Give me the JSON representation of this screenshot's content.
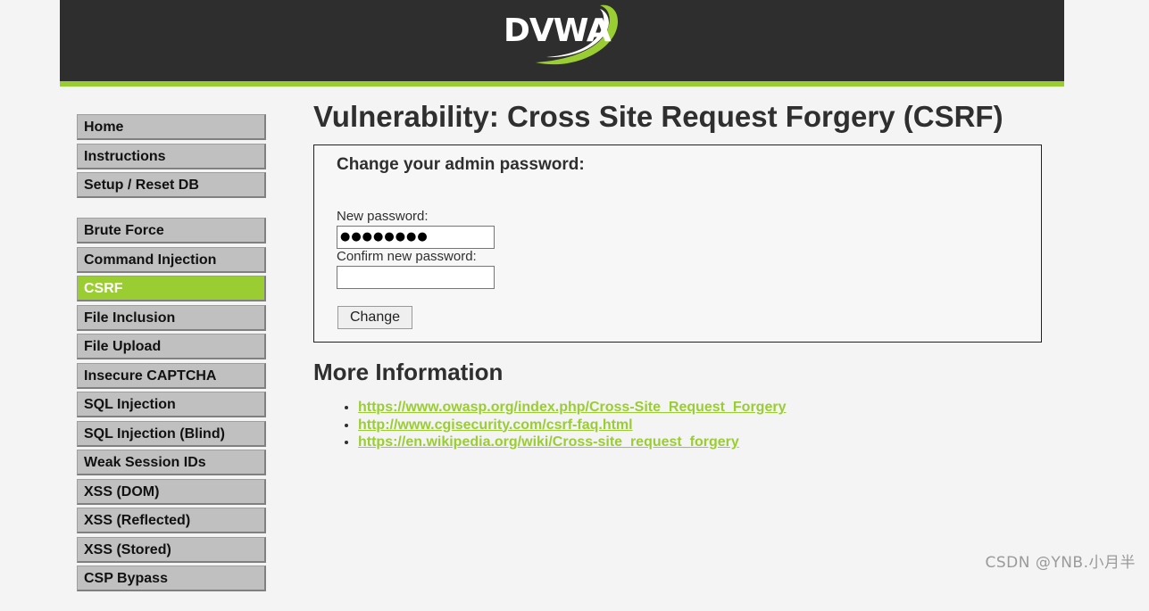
{
  "header": {
    "logo_text": "DVWA"
  },
  "sidebar": {
    "groups": [
      [
        {
          "label": "Home"
        },
        {
          "label": "Instructions"
        },
        {
          "label": "Setup / Reset DB"
        }
      ],
      [
        {
          "label": "Brute Force"
        },
        {
          "label": "Command Injection"
        },
        {
          "label": "CSRF",
          "selected": true
        },
        {
          "label": "File Inclusion"
        },
        {
          "label": "File Upload"
        },
        {
          "label": "Insecure CAPTCHA"
        },
        {
          "label": "SQL Injection"
        },
        {
          "label": "SQL Injection (Blind)"
        },
        {
          "label": "Weak Session IDs"
        },
        {
          "label": "XSS (DOM)"
        },
        {
          "label": "XSS (Reflected)"
        },
        {
          "label": "XSS (Stored)"
        },
        {
          "label": "CSP Bypass"
        }
      ]
    ]
  },
  "main": {
    "title": "Vulnerability: Cross Site Request Forgery (CSRF)",
    "form": {
      "heading": "Change your admin password:",
      "new_password_label": "New password:",
      "new_password_value": "●●●●●●●●",
      "confirm_password_label": "Confirm new password:",
      "confirm_password_value": "",
      "submit_label": "Change"
    },
    "more_info": {
      "title": "More Information",
      "links": [
        "https://www.owasp.org/index.php/Cross-Site_Request_Forgery",
        "http://www.cgisecurity.com/csrf-faq.html",
        "https://en.wikipedia.org/wiki/Cross-site_request_forgery"
      ]
    }
  },
  "watermark": "CSDN @YNB.小月半",
  "colors": {
    "accent": "#9acd32",
    "header_bg": "#2e2e2e",
    "menu_bg": "#c0c0c0"
  }
}
